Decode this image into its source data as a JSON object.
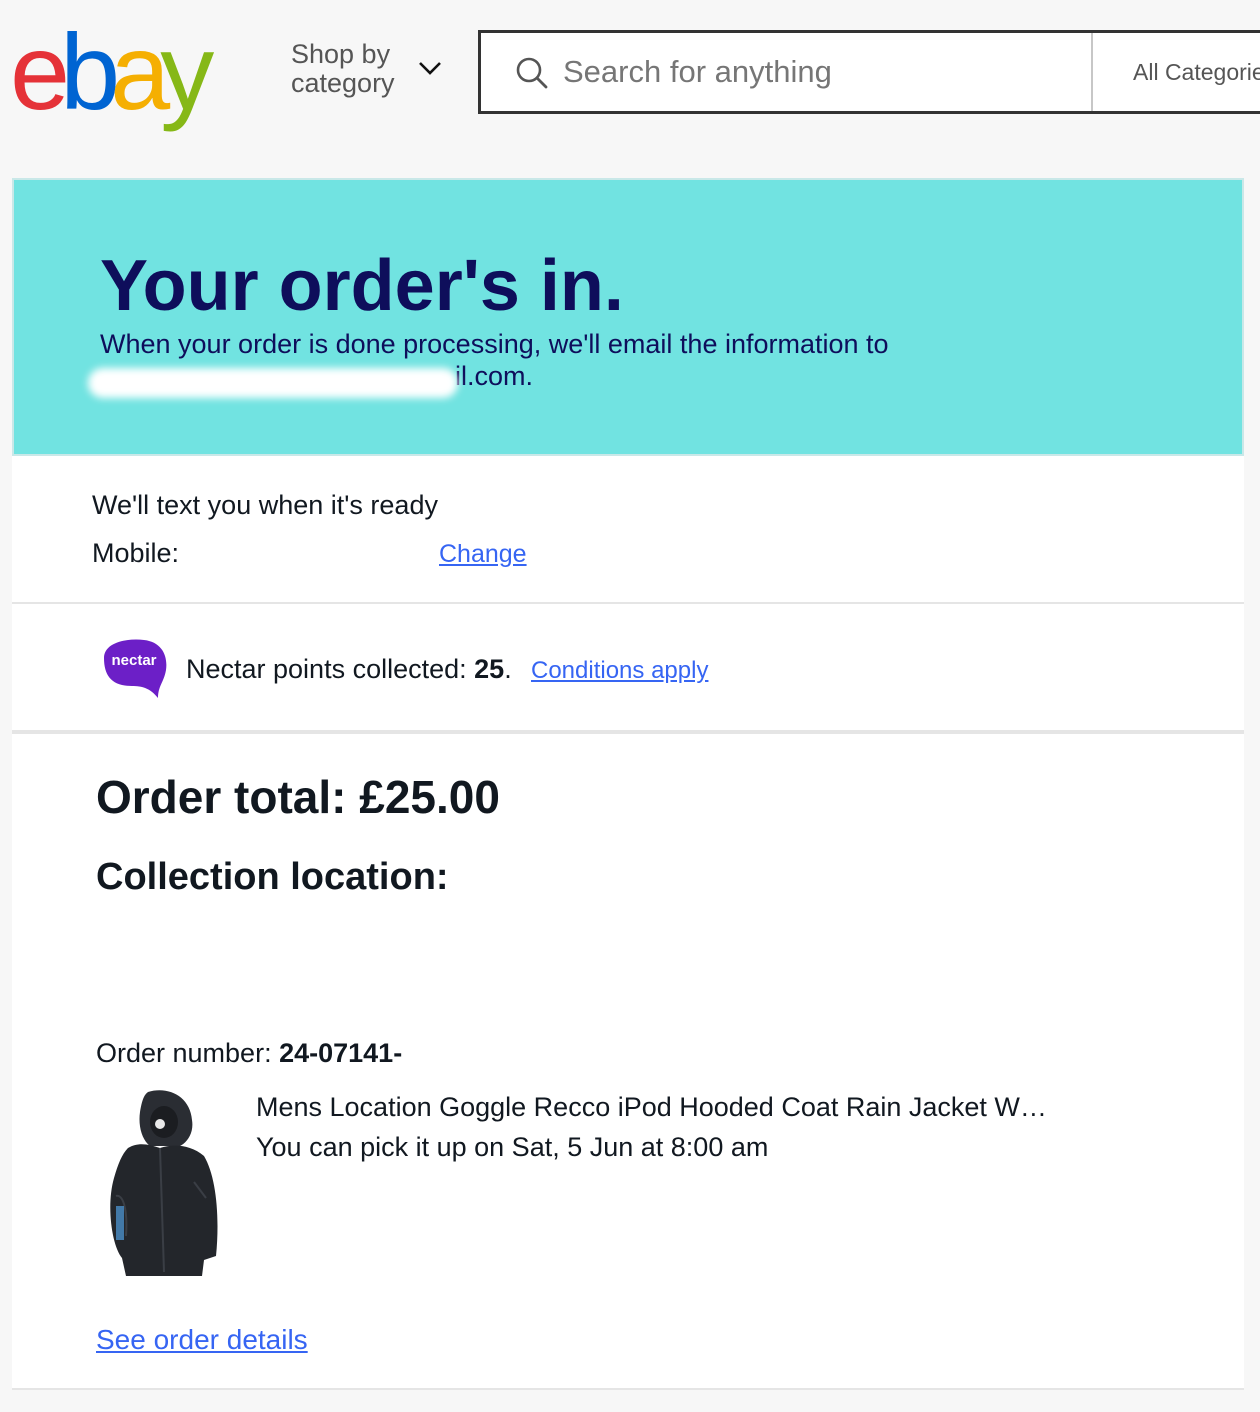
{
  "header": {
    "logo_letters": [
      "e",
      "b",
      "a",
      "y"
    ],
    "logo_colors": [
      "#e53238",
      "#0064d2",
      "#f5af02",
      "#86b817"
    ],
    "shop_by_label": "Shop by category",
    "search_placeholder": "Search for anything",
    "category_select": "All Categories"
  },
  "hero": {
    "title": "Your order's in.",
    "message": "When your order is done processing, we'll email the information to",
    "email_visible_part": "il.com."
  },
  "sms": {
    "heading": "We'll text you when it's ready",
    "mobile_label": "Mobile:",
    "change_link": "Change"
  },
  "nectar": {
    "logo_text": "nectar",
    "text": "Nectar points collected:",
    "points": "25",
    "points_suffix": ".",
    "conditions_link": "Conditions apply"
  },
  "order": {
    "total_label": "Order total: £25.00",
    "collection_label": "Collection location:",
    "number_label": "Order number:",
    "number_value": "24-07141-",
    "item_title": "Mens Location Goggle Recco iPod Hooded Coat Rain Jacket W…",
    "pickup_text": "You can pick it up on Sat, 5 Jun at 8:00 am",
    "see_details_link": "See order details"
  },
  "colors": {
    "hero_bg": "#71e3e1",
    "hero_text": "#0e0e5b",
    "link": "#3665f3",
    "nectar_purple": "#6c1fc7"
  }
}
